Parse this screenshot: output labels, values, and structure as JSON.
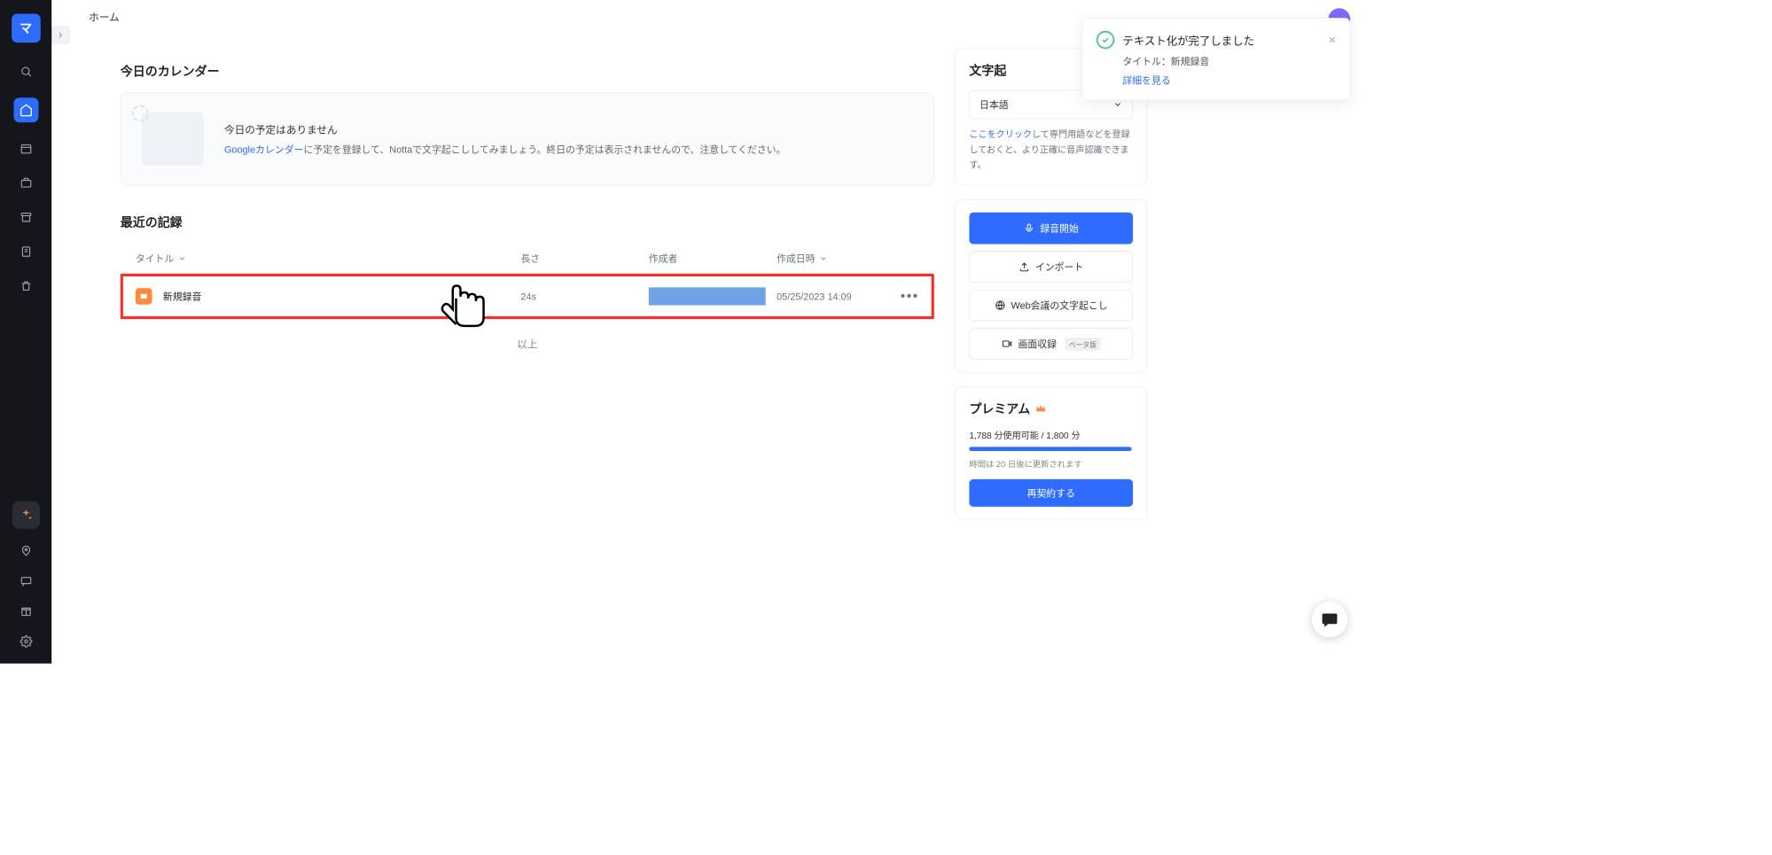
{
  "breadcrumb": "ホーム",
  "calendar": {
    "section_title": "今日のカレンダー",
    "no_events": "今日の予定はありません",
    "link_text": "Googleカレンダー",
    "sub_text": "に予定を登録して、Nottaで文字起こししてみましょう。終日の予定は表示されませんので、注意してください。"
  },
  "records": {
    "section_title": "最近の記録",
    "columns": {
      "title": "タイトル",
      "length": "長さ",
      "author": "作成者",
      "created": "作成日時"
    },
    "items": [
      {
        "title": "新規録音",
        "length": "24s",
        "created": "05/25/2023 14:09"
      }
    ],
    "end": "以上"
  },
  "right": {
    "transcribe_title": "文字起",
    "lang": "日本語",
    "tip_link": "ここをクリック",
    "tip_rest": "して専門用語などを登録しておくと、より正確に音声認識できます。",
    "actions": {
      "record": "録音開始",
      "import": "インポート",
      "webmtg": "Web会議の文字起こし",
      "screenrec": "画面収録",
      "beta": "ベータ版"
    },
    "premium": {
      "title": "プレミアム",
      "usage": "1,788 分使用可能 / 1,800 分",
      "usage_pct": 99,
      "renewal": "時間は 20 日後に更新されます",
      "renew_btn": "再契約する"
    }
  },
  "toast": {
    "title": "テキスト化が完了しました",
    "subtitle": "タイトル：新規録音",
    "link": "詳細を見る"
  }
}
